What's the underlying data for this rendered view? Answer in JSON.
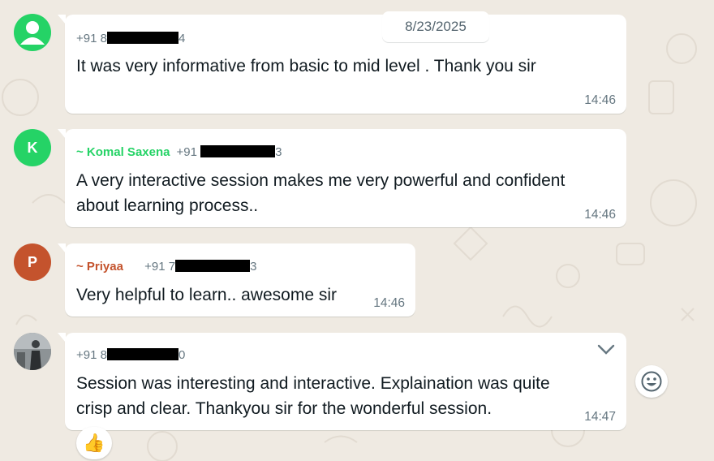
{
  "date_divider": "8/23/2025",
  "messages": [
    {
      "avatar_initial": "",
      "name": "",
      "phone_prefix": "+91",
      "phone_mid": "8",
      "phone_suffix": "4",
      "text": "It was very informative from basic to mid level . Thank you sir",
      "time": "14:46"
    },
    {
      "avatar_initial": "K",
      "name": "~ Komal Saxena",
      "phone_prefix": "+91",
      "phone_mid": "",
      "phone_suffix": "3",
      "text_line1": "A very interactive session makes me very powerful and confident",
      "text_line2": "about learning process..",
      "time": "14:46"
    },
    {
      "avatar_initial": "P",
      "name": "~ Priyaa",
      "phone_prefix": "+91 7",
      "phone_mid": "",
      "phone_suffix": "3",
      "text": "Very helpful to learn.. awesome sir",
      "time": "14:46"
    },
    {
      "avatar_initial": "",
      "name": "",
      "phone_prefix": "+91",
      "phone_mid": "8",
      "phone_suffix": "0",
      "text_line1": "Session was interesting and interactive. Explaination was quite",
      "text_line2": "crisp and clear. Thankyou sir for the wonderful session.",
      "time": "14:47",
      "reaction": "👍"
    }
  ],
  "colors": {
    "background": "#efeae2",
    "default_avatar": "#25d366",
    "komal_avatar": "#25d366",
    "komal_name": "#25d366",
    "priyaa_avatar": "#c4532d",
    "priyaa_name": "#c4532d",
    "meta_text": "#667781"
  },
  "icons": [
    "default-user-avatar-icon",
    "chevron-down-icon",
    "emoji-smiley-icon",
    "thumbs-up-reaction"
  ]
}
